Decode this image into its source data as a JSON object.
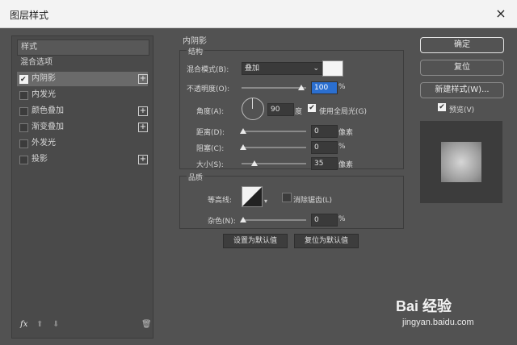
{
  "window": {
    "title": "图层样式",
    "close": "×"
  },
  "left": {
    "header": "样式",
    "blend": "混合选项",
    "items": [
      {
        "label": "内阴影",
        "checked": true,
        "plus": true,
        "selected": true
      },
      {
        "label": "内发光",
        "checked": false,
        "plus": false
      },
      {
        "label": "颜色叠加",
        "checked": false,
        "plus": true
      },
      {
        "label": "渐变叠加",
        "checked": false,
        "plus": true
      },
      {
        "label": "外发光",
        "checked": false,
        "plus": false
      },
      {
        "label": "投影",
        "checked": false,
        "plus": true
      }
    ],
    "footer": {
      "fx": "fx",
      "up": "⬆",
      "down": "⬇",
      "trash": "🗑"
    }
  },
  "panel": {
    "title": "内阴影",
    "structure": "结构",
    "blend_mode_label": "混合模式(B):",
    "blend_mode_value": "叠加",
    "opacity_label": "不透明度(O):",
    "opacity_value": "100",
    "percent": "%",
    "angle_label": "角度(A):",
    "angle_value": "90",
    "degree": "度",
    "global_light": "使用全局光(G)",
    "distance_label": "距离(D):",
    "distance_value": "0",
    "choke_label": "阻塞(C):",
    "choke_value": "0",
    "size_label": "大小(S):",
    "size_value": "35",
    "px": "像素",
    "quality": "品质",
    "contour_label": "等高线:",
    "antialias": "消除锯齿(L)",
    "noise_label": "杂色(N):",
    "noise_value": "0",
    "set_default": "设置为默认值",
    "reset_default": "复位为默认值"
  },
  "right": {
    "ok": "确定",
    "reset": "复位",
    "new_style": "新建样式(W)...",
    "preview": "预览(V)"
  },
  "watermark": {
    "brand": "Bai 经验",
    "url": "jingyan.baidu.com"
  }
}
